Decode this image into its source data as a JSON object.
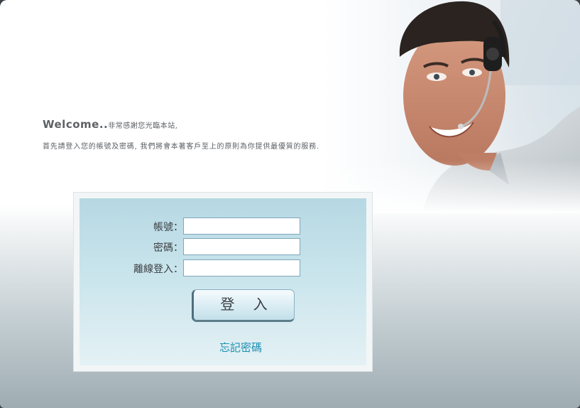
{
  "welcome": {
    "greeting": "Welcome..",
    "message": "非常感謝您光臨本站,",
    "intro": "首先請登入您的帳號及密碼, 我們將會本著客戶至上的原則為你提供最優質的服務."
  },
  "login_form": {
    "account_label": "帳號：",
    "password_label": "密碼：",
    "offline_label": "離線登入：",
    "account_value": "",
    "password_value": "",
    "offline_value": "",
    "login_button": "登 入",
    "forgot_link": "忘記密碼"
  },
  "colors": {
    "link": "#1c8fb0",
    "panel": "#c9e4ec",
    "input_border": "#7fa7bb"
  }
}
